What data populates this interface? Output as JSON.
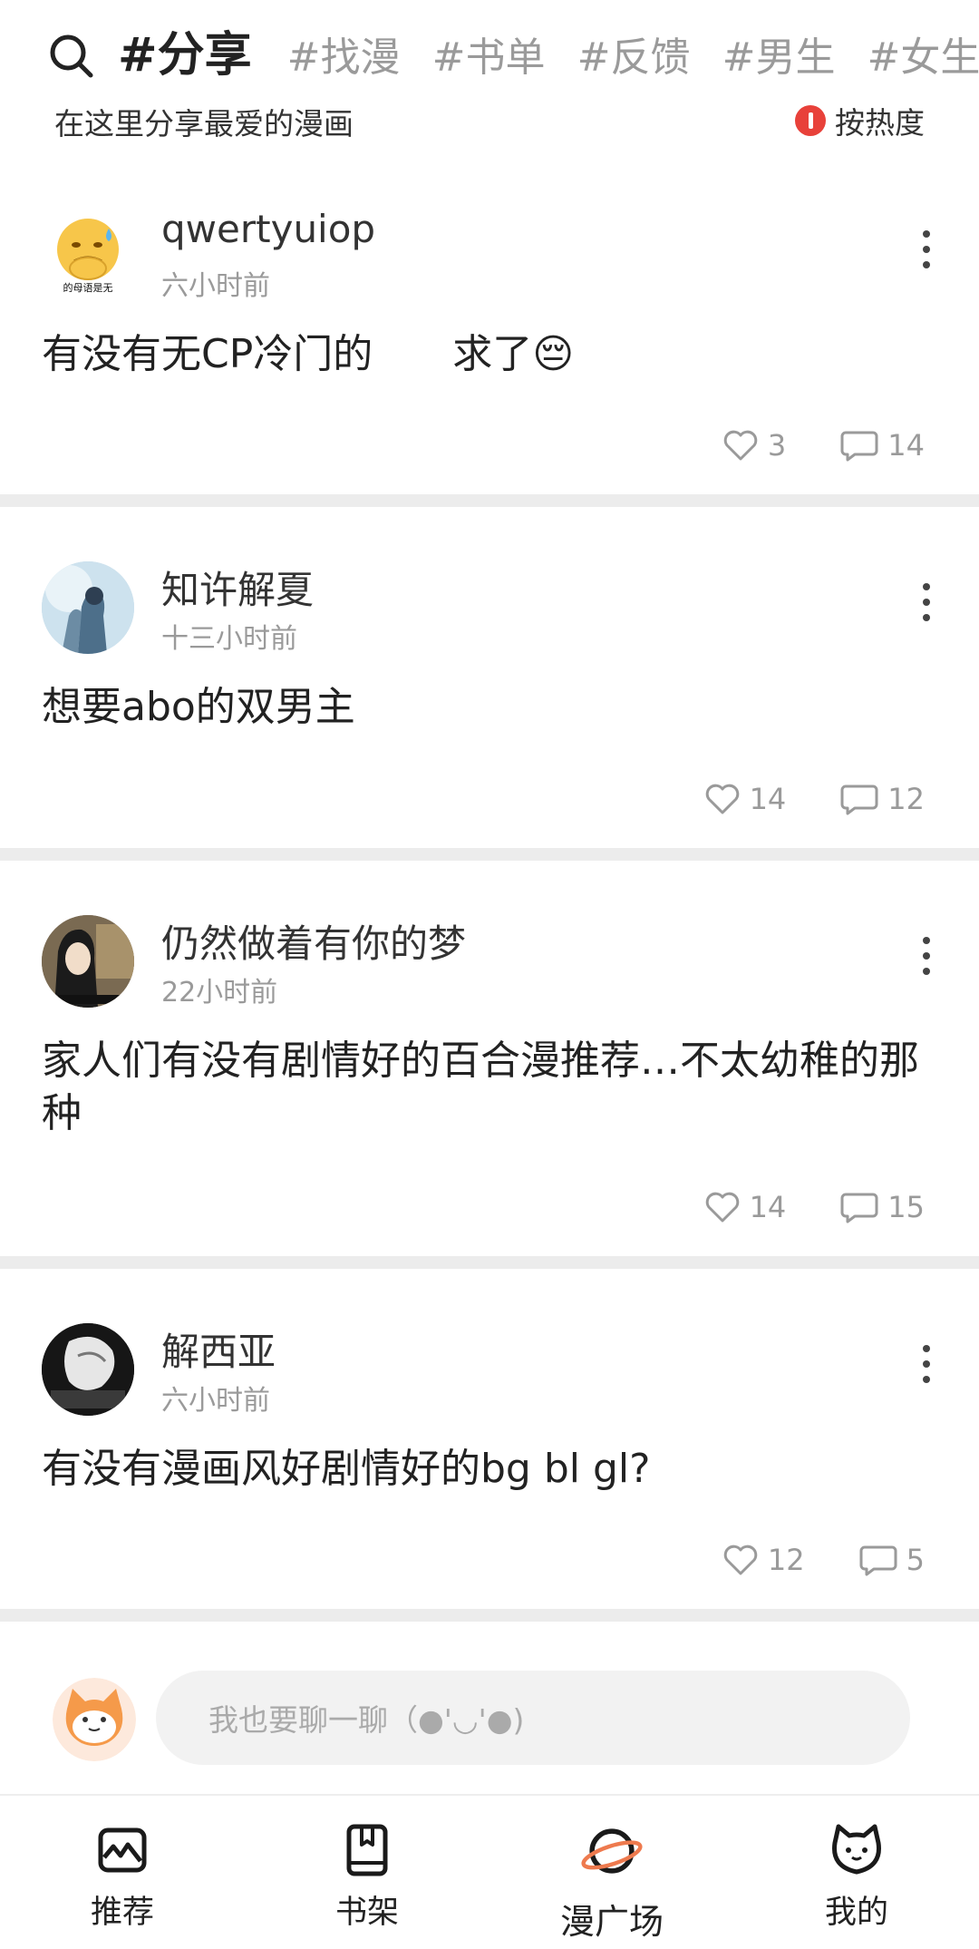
{
  "header": {
    "tabs": [
      {
        "label": "#分享",
        "active": true
      },
      {
        "label": "#找漫",
        "active": false
      },
      {
        "label": "#书单",
        "active": false
      },
      {
        "label": "#反馈",
        "active": false
      },
      {
        "label": "#男生",
        "active": false
      },
      {
        "label": "#女生",
        "active": false
      },
      {
        "label": "#",
        "active": false
      }
    ],
    "subtitle": "在这里分享最爱的漫画",
    "sort_label": "按热度",
    "accent_color": "#e8413a"
  },
  "posts": [
    {
      "username": "qwertyuiop",
      "time": "六小时前",
      "content": "有没有无CP冷门的　　求了😔",
      "likes": "3",
      "comments": "14",
      "avatar_icon": "emoji-avatar-icon"
    },
    {
      "username": "知许解夏",
      "time": "十三小时前",
      "content": "想要abo的双男主",
      "likes": "14",
      "comments": "12",
      "avatar_icon": "blue-illustration-avatar"
    },
    {
      "username": "仍然做着有你的梦",
      "time": "22小时前",
      "content": "家人们有没有剧情好的百合漫推荐…不太幼稚的那种",
      "likes": "14",
      "comments": "15",
      "avatar_icon": "photo-avatar"
    },
    {
      "username": "解西亚",
      "time": "六小时前",
      "content": "有没有漫画风好剧情好的bg bl gl?",
      "likes": "12",
      "comments": "5",
      "avatar_icon": "dark-illustration-avatar"
    }
  ],
  "composer": {
    "placeholder": "我也要聊一聊（●'◡'●)"
  },
  "bottom_nav": [
    {
      "label": "推荐",
      "icon": "recommend-icon",
      "active": false
    },
    {
      "label": "书架",
      "icon": "bookshelf-icon",
      "active": false
    },
    {
      "label": "漫广场",
      "icon": "planet-icon",
      "active": true
    },
    {
      "label": "我的",
      "icon": "cat-face-icon",
      "active": false
    }
  ]
}
